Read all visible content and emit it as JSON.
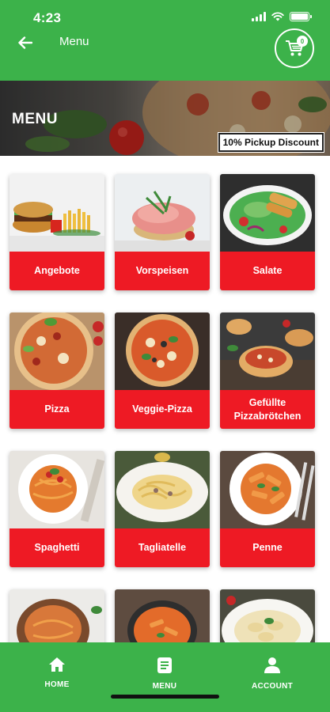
{
  "status_bar": {
    "time": "4:23"
  },
  "header": {
    "title": "Menu",
    "cart_count": "0"
  },
  "banner": {
    "title": "MENU",
    "discount": "10% Pickup Discount"
  },
  "categories": [
    {
      "label": "Angebote"
    },
    {
      "label": "Vorspeisen"
    },
    {
      "label": "Salate"
    },
    {
      "label": "Pizza"
    },
    {
      "label": "Veggie-Pizza"
    },
    {
      "label": "Gefüllte Pizzabrötchen"
    },
    {
      "label": "Spaghetti"
    },
    {
      "label": "Tagliatelle"
    },
    {
      "label": "Penne"
    },
    {
      "label": ""
    },
    {
      "label": ""
    },
    {
      "label": ""
    }
  ],
  "bottom_nav": {
    "home": "HOME",
    "menu": "MENU",
    "account": "ACCOUNT"
  },
  "colors": {
    "primary": "#3cb24a",
    "category_label_bg": "#ee1a24",
    "discount_bg": "#ffffff"
  }
}
